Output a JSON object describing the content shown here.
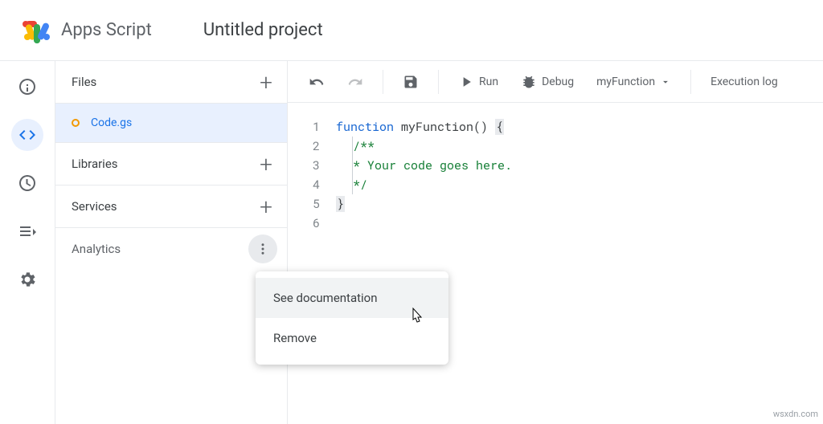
{
  "header": {
    "app_name": "Apps Script",
    "project_title": "Untitled project"
  },
  "sidebar": {
    "files_label": "Files",
    "file_name": "Code.gs",
    "libraries_label": "Libraries",
    "services_label": "Services",
    "analytics_label": "Analytics"
  },
  "toolbar": {
    "run_label": "Run",
    "debug_label": "Debug",
    "fn_name": "myFunction",
    "exec_log": "Execution log"
  },
  "editor": {
    "lines": [
      "1",
      "2",
      "3",
      "4",
      "5",
      "6"
    ],
    "kw_function": "function",
    "fn_name": " myFunction() ",
    "brace_open": "{",
    "comment_open": "/**",
    "comment_body": "* Your code goes here.",
    "comment_close": "*/",
    "brace_close": "}"
  },
  "context_menu": {
    "see_docs": "See documentation",
    "remove": "Remove"
  },
  "watermark": "wsxdn.com"
}
